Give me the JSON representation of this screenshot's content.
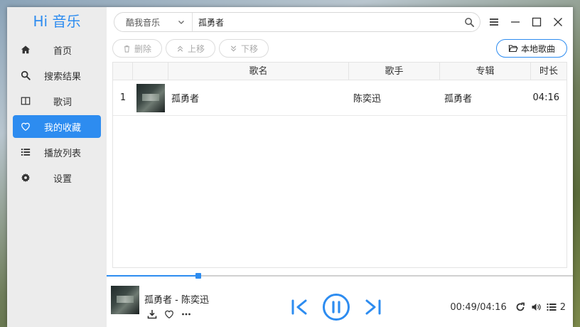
{
  "app": {
    "title": "Hi 音乐"
  },
  "sidebar": {
    "items": [
      {
        "label": "首页",
        "icon": "home-icon",
        "active": false
      },
      {
        "label": "搜索结果",
        "icon": "search-icon",
        "active": false
      },
      {
        "label": "歌词",
        "icon": "book-icon",
        "active": false
      },
      {
        "label": "我的收藏",
        "icon": "heart-icon",
        "active": true
      },
      {
        "label": "播放列表",
        "icon": "list-icon",
        "active": false
      },
      {
        "label": "设置",
        "icon": "gear-icon",
        "active": false
      }
    ]
  },
  "search": {
    "source": "酷我音乐",
    "value": "孤勇者"
  },
  "toolbar": {
    "delete_label": "删除",
    "move_up_label": "上移",
    "move_down_label": "下移",
    "local_songs_label": "本地歌曲"
  },
  "table": {
    "headers": {
      "index": "",
      "cover": "",
      "title": "歌名",
      "artist": "歌手",
      "album": "专辑",
      "duration": "时长"
    },
    "rows": [
      {
        "index": "1",
        "title": "孤勇者",
        "artist": "陈奕迅",
        "album": "孤勇者",
        "duration": "04:16"
      }
    ]
  },
  "player": {
    "now_playing": "孤勇者 - 陈奕迅",
    "time": "00:49/04:16",
    "progress": 0.196,
    "playlist_count": "2"
  },
  "colors": {
    "accent": "#2d8cf0",
    "sidebar_bg": "#ececec"
  }
}
